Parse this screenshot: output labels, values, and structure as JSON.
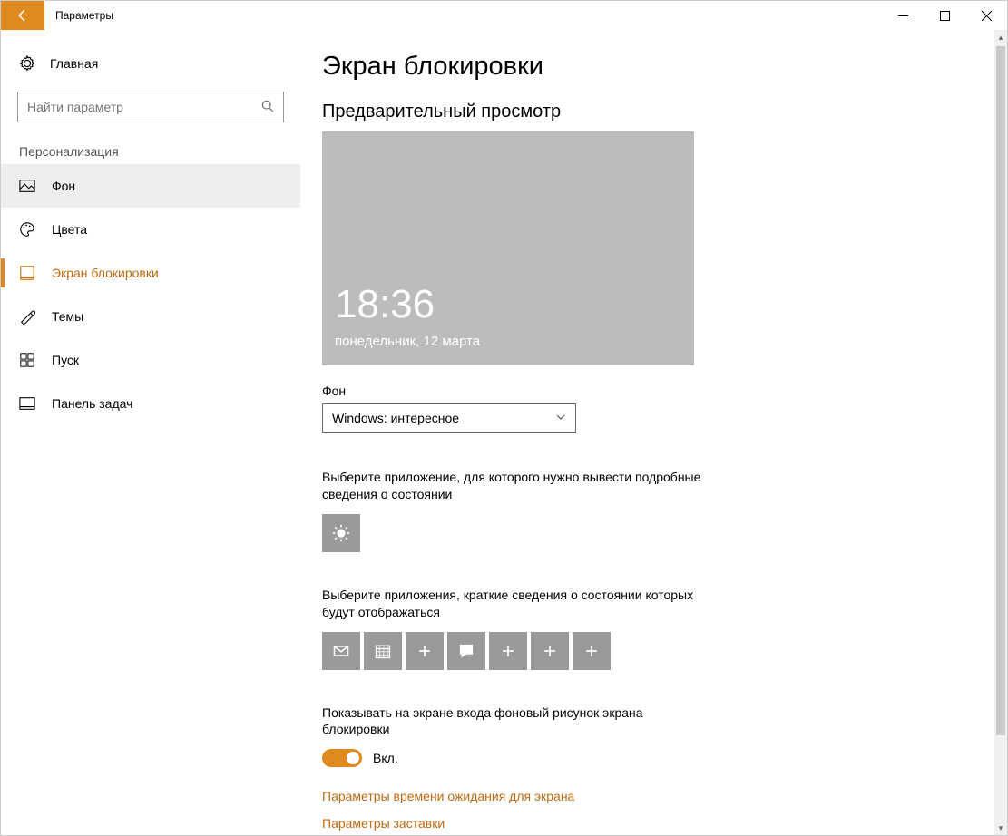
{
  "titlebar": {
    "title": "Параметры"
  },
  "sidebar": {
    "home": "Главная",
    "search_placeholder": "Найти параметр",
    "category": "Персонализация",
    "items": [
      {
        "label": "Фон",
        "icon": "picture-icon",
        "selected": true
      },
      {
        "label": "Цвета",
        "icon": "palette-icon"
      },
      {
        "label": "Экран блокировки",
        "icon": "lockscreen-icon",
        "active": true
      },
      {
        "label": "Темы",
        "icon": "themes-icon"
      },
      {
        "label": "Пуск",
        "icon": "start-icon"
      },
      {
        "label": "Панель задач",
        "icon": "taskbar-icon"
      }
    ]
  },
  "main": {
    "heading": "Экран блокировки",
    "preview_label": "Предварительный просмотр",
    "preview": {
      "time": "18:36",
      "date": "понедельник, 12 марта"
    },
    "bg_label": "Фон",
    "bg_value": "Windows: интересное",
    "detailed_text": "Выберите приложение, для которого нужно вывести подробные сведения о состоянии",
    "quick_text": "Выберите приложения, краткие сведения о состоянии которых будут отображаться",
    "quick_tiles": [
      "mail-icon",
      "calendar-icon",
      "plus-icon",
      "chat-icon",
      "plus-icon",
      "plus-icon",
      "plus-icon"
    ],
    "show_bg_text": "Показывать на экране входа фоновый рисунок экрана блокировки",
    "toggle_state": "Вкл.",
    "link1": "Параметры времени ожидания для экрана",
    "link2": "Параметры заставки"
  },
  "colors": {
    "accent": "#e08a1e",
    "link": "#c06a10",
    "tile": "#9a9a9a",
    "preview_bg": "#bcbcbc"
  }
}
